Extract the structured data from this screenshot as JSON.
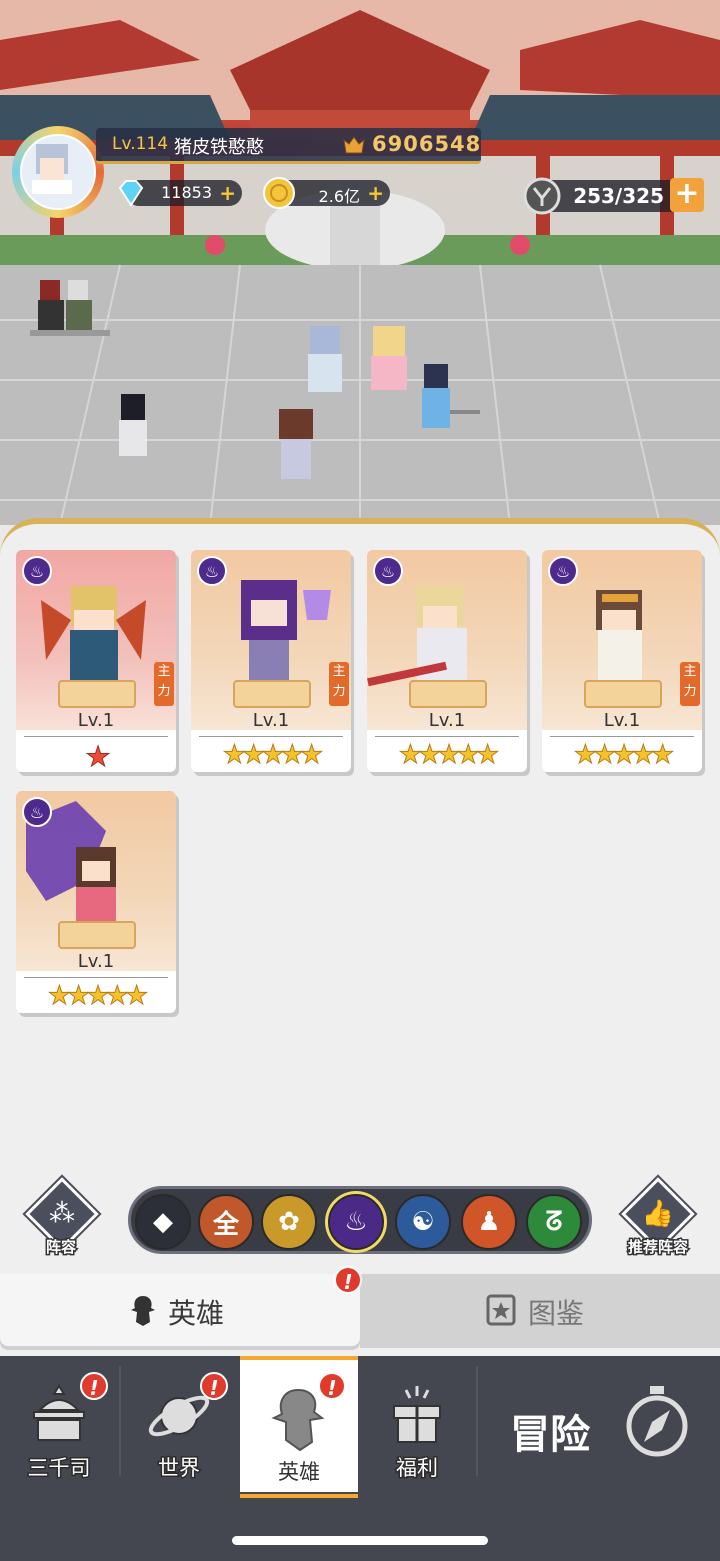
{
  "player": {
    "level": "Lv.114",
    "name": "猪皮铁憨憨",
    "power": "6906548"
  },
  "resources": {
    "gems": "11853",
    "gold": "2.6亿",
    "stamina": "253/325",
    "plus": "+"
  },
  "heroes": [
    {
      "level": "Lv.1",
      "stars": "★",
      "star_color": "red",
      "main_tag": "主力",
      "bg": "red"
    },
    {
      "level": "Lv.1",
      "stars": "★★★★★",
      "star_color": "gold",
      "main_tag": "主力",
      "bg": "orange"
    },
    {
      "level": "Lv.1",
      "stars": "★★★★★",
      "star_color": "gold",
      "main_tag": "",
      "bg": "orange"
    },
    {
      "level": "Lv.1",
      "stars": "★★★★★",
      "star_color": "gold",
      "main_tag": "主力",
      "bg": "orange"
    },
    {
      "level": "Lv.1",
      "stars": "★★★★★",
      "star_color": "gold",
      "main_tag": "",
      "bg": "orange"
    }
  ],
  "filters": {
    "lineup_label": "阵容",
    "recommend_label": "推荐阵容",
    "elements": [
      {
        "icon": "layers-icon",
        "glyph": "◆",
        "color": "#2d2f38"
      },
      {
        "icon": "all-icon",
        "glyph": "全",
        "color": "#c0582c"
      },
      {
        "icon": "lotus-icon",
        "glyph": "✿",
        "color": "#c99a2a"
      },
      {
        "icon": "dark-flame-icon",
        "glyph": "♨",
        "color": "#4b2a87"
      },
      {
        "icon": "yin-yang-icon",
        "glyph": "☯",
        "color": "#2d5a9a"
      },
      {
        "icon": "meditation-icon",
        "glyph": "♟",
        "color": "#d0562a"
      },
      {
        "icon": "dna-icon",
        "glyph": "ᘔ",
        "color": "#2d8a3a"
      }
    ],
    "selected_index": 3
  },
  "tabs": {
    "hero": "英雄",
    "codex": "图鉴"
  },
  "nav": {
    "items": [
      "三千司",
      "世界",
      "英雄",
      "福利"
    ],
    "adventure": "冒险",
    "alert": "!"
  }
}
